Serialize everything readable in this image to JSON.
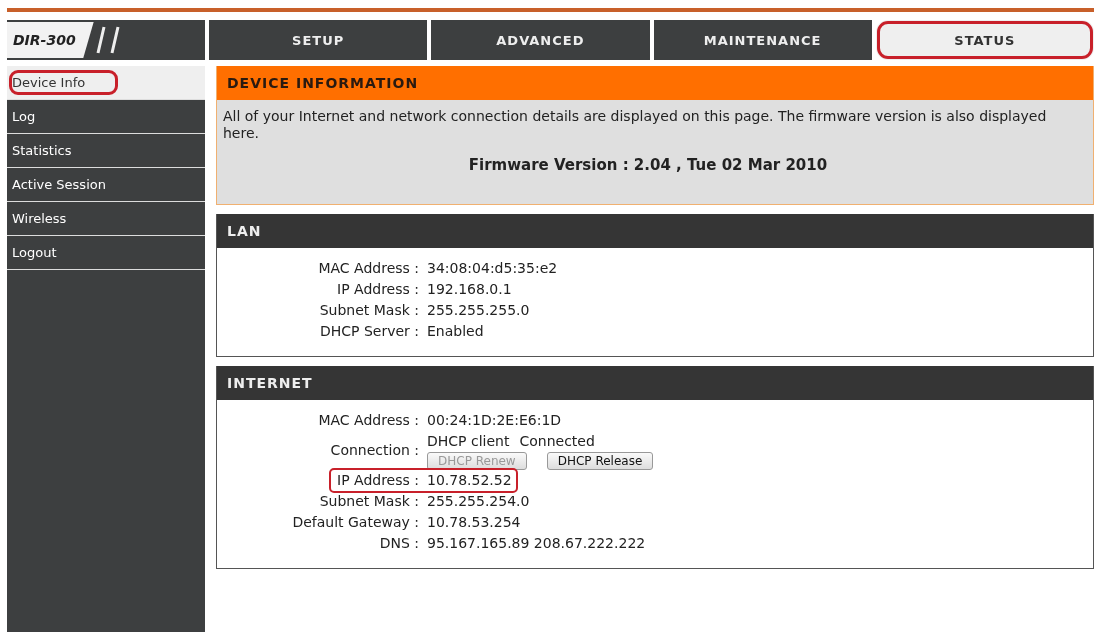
{
  "logo": "DIR-300",
  "tabs": [
    {
      "label": "SETUP",
      "selected": false,
      "highlighted": false
    },
    {
      "label": "ADVANCED",
      "selected": false,
      "highlighted": false
    },
    {
      "label": "MAINTENANCE",
      "selected": false,
      "highlighted": false
    },
    {
      "label": "STATUS",
      "selected": true,
      "highlighted": true
    }
  ],
  "sidebar": {
    "items": [
      {
        "label": "Device Info",
        "selected": true,
        "highlighted": true
      },
      {
        "label": "Log",
        "selected": false,
        "highlighted": false
      },
      {
        "label": "Statistics",
        "selected": false,
        "highlighted": false
      },
      {
        "label": "Active Session",
        "selected": false,
        "highlighted": false
      },
      {
        "label": "Wireless",
        "selected": false,
        "highlighted": false
      },
      {
        "label": "Logout",
        "selected": false,
        "highlighted": false
      }
    ]
  },
  "device_information": {
    "title": "DEVICE INFORMATION",
    "description": "All of your Internet and network connection details are displayed on this page. The firmware version is also displayed here.",
    "firmware": "Firmware Version : 2.04 ,  Tue 02 Mar 2010"
  },
  "lan": {
    "title": "LAN",
    "rows": [
      {
        "kind": "text",
        "label": "MAC Address :",
        "value": "34:08:04:d5:35:e2",
        "highlighted": false
      },
      {
        "kind": "text",
        "label": "IP Address :",
        "value": "192.168.0.1",
        "highlighted": false
      },
      {
        "kind": "text",
        "label": "Subnet Mask :",
        "value": "255.255.255.0",
        "highlighted": false
      },
      {
        "kind": "text",
        "label": "DHCP Server :",
        "value": "Enabled",
        "highlighted": false
      }
    ]
  },
  "internet": {
    "title": "INTERNET",
    "rows": [
      {
        "kind": "text",
        "label": "MAC Address :",
        "value": "00:24:1D:2E:E6:1D",
        "highlighted": false
      },
      {
        "kind": "connection",
        "label": "Connection :",
        "value": "DHCP client",
        "status": "Connected",
        "buttons": [
          {
            "label": "DHCP Renew",
            "disabled": true
          },
          {
            "label": "DHCP Release",
            "disabled": false
          }
        ],
        "highlighted": false
      },
      {
        "kind": "text",
        "label": "IP Address :",
        "value": "10.78.52.52",
        "highlighted": true
      },
      {
        "kind": "text",
        "label": "Subnet Mask :",
        "value": "255.255.254.0",
        "highlighted": false
      },
      {
        "kind": "text",
        "label": "Default Gateway :",
        "value": "10.78.53.254",
        "highlighted": false
      },
      {
        "kind": "text",
        "label": "DNS :",
        "value": "95.167.165.89 208.67.222.222",
        "highlighted": false
      }
    ]
  }
}
